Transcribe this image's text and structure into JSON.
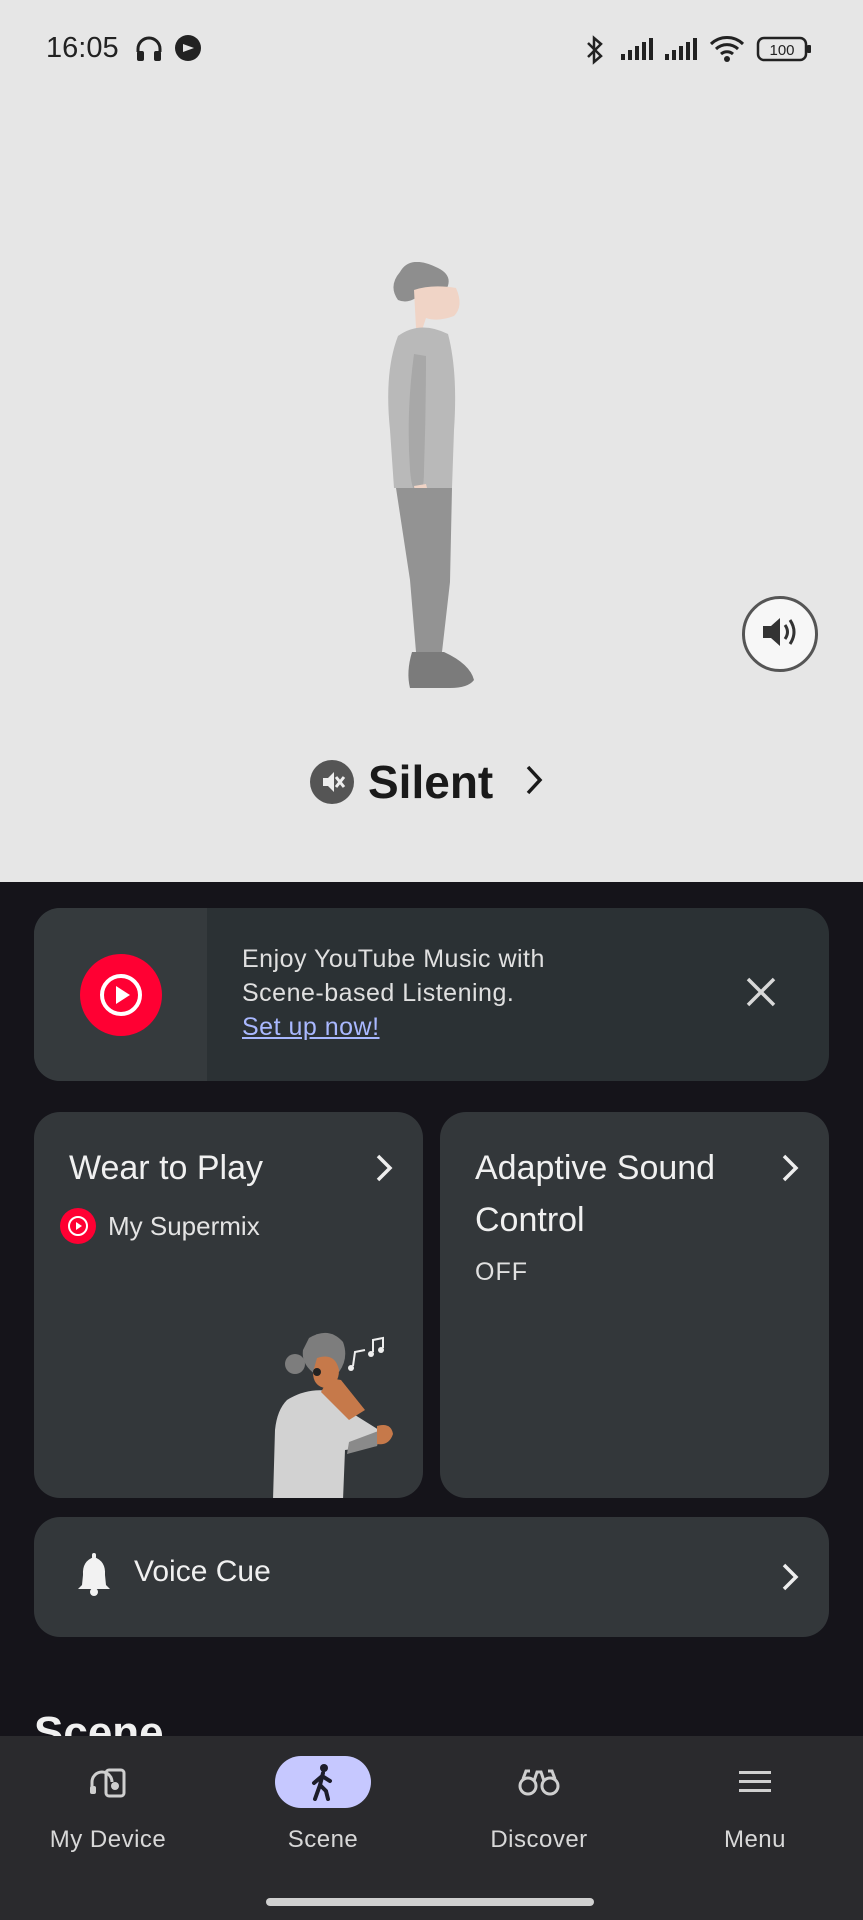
{
  "status_bar": {
    "time": "16:05",
    "icons": [
      "headphones-icon",
      "app-notification-icon",
      "bluetooth-icon",
      "signal-icon",
      "signal-icon",
      "wifi-icon"
    ],
    "battery": "100"
  },
  "hero": {
    "mode_label": "Silent",
    "mode_icon": "silent-mode-icon",
    "volume_icon": "speaker-volume-icon"
  },
  "promo": {
    "line1": "Enjoy YouTube Music with",
    "line2": "Scene-based Listening.",
    "link": "Set up now!",
    "accent": "#ff0033"
  },
  "cards": {
    "wear_to_play": {
      "title": "Wear to Play",
      "playlist": "My Supermix"
    },
    "adaptive_sound": {
      "title_line1": "Adaptive Sound",
      "title_line2": "Control",
      "status": "OFF"
    },
    "voice_cue": {
      "title": "Voice Cue"
    }
  },
  "section_peek": "Scene",
  "nav": {
    "items": [
      {
        "label": "My Device",
        "icon": "device-icon"
      },
      {
        "label": "Scene",
        "icon": "walking-person-icon",
        "active": true
      },
      {
        "label": "Discover",
        "icon": "binoculars-icon"
      },
      {
        "label": "Menu",
        "icon": "menu-icon"
      }
    ],
    "active_color": "#c6c8ff"
  }
}
